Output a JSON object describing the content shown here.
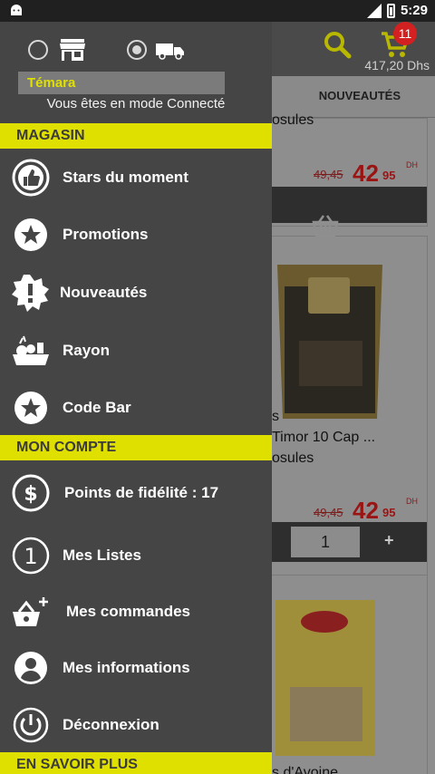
{
  "status_bar": {
    "time": "5:29",
    "network": "LTE"
  },
  "header": {
    "cart_count": "11",
    "cart_total": "417,20 Dhs",
    "tab_label": "NOUVEAUTÉS"
  },
  "drawer": {
    "city": "Témara",
    "mode_text": "Vous êtes en mode Connecté",
    "sections": {
      "store": "MAGASIN",
      "account": "MON COMPTE",
      "more": "EN SAVOIR PLUS"
    },
    "store_items": [
      {
        "label": "Stars du moment",
        "icon": "thumbs-up-icon"
      },
      {
        "label": "Promotions",
        "icon": "star-icon"
      },
      {
        "label": "Nouveautés",
        "icon": "badge-exclamation-icon"
      },
      {
        "label": "Rayon",
        "icon": "grocery-icon"
      },
      {
        "label": "Code Bar",
        "icon": "star-icon"
      }
    ],
    "account_items": [
      {
        "label": "Points de fidélité : 17",
        "icon": "dollar-icon"
      },
      {
        "label": "Mes Listes",
        "icon": "number-one-icon"
      },
      {
        "label": "Mes commandes",
        "icon": "basket-plus-icon"
      },
      {
        "label": "Mes informations",
        "icon": "user-icon"
      },
      {
        "label": "Déconnexion",
        "icon": "power-icon"
      }
    ]
  },
  "products": {
    "p1": {
      "line2": "osules",
      "price_old": "49,45",
      "price_int": "42",
      "price_dec": "95",
      "currency": "DH"
    },
    "p2": {
      "line1": "s",
      "line2": "Timor 10 Cap ...",
      "line3": "osules",
      "price_old": "49,45",
      "price_int": "42",
      "price_dec": "95",
      "currency": "DH",
      "quantity": "1",
      "plus": "+"
    },
    "p3": {
      "name_partial": "s d'Avoine"
    }
  },
  "colors": {
    "accent_yellow": "#e0e000",
    "drawer_bg": "#454545",
    "price_red": "#c0161b"
  }
}
